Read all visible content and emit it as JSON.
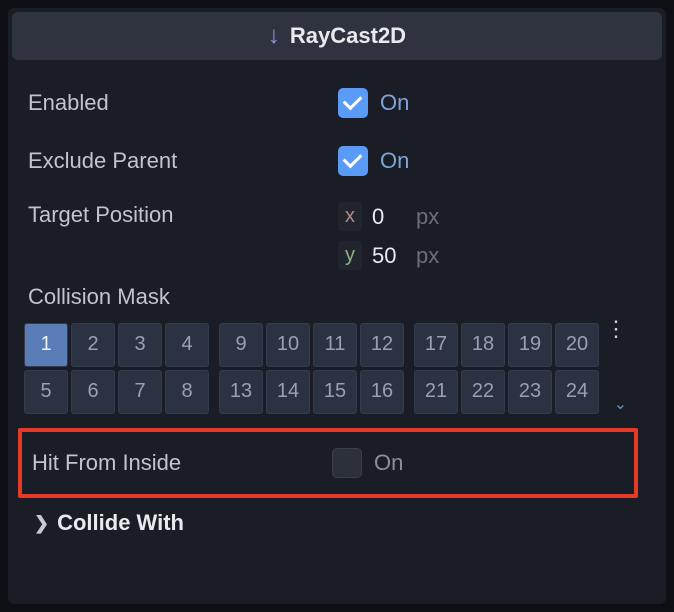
{
  "header": {
    "title": "RayCast2D"
  },
  "props": {
    "enabled": {
      "label": "Enabled",
      "checked": true,
      "text": "On"
    },
    "exclude_parent": {
      "label": "Exclude Parent",
      "checked": true,
      "text": "On"
    },
    "target_position": {
      "label": "Target Position",
      "x": {
        "axis": "x",
        "value": "0",
        "unit": "px"
      },
      "y": {
        "axis": "y",
        "value": "50",
        "unit": "px"
      }
    },
    "collision_mask": {
      "label": "Collision Mask",
      "active": [
        1
      ],
      "groups": [
        [
          1,
          2,
          3,
          4,
          5,
          6,
          7,
          8
        ],
        [
          9,
          10,
          11,
          12,
          13,
          14,
          15,
          16
        ],
        [
          17,
          18,
          19,
          20,
          21,
          22,
          23,
          24
        ]
      ]
    },
    "hit_from_inside": {
      "label": "Hit From Inside",
      "checked": false,
      "text": "On"
    },
    "collide_with": {
      "label": "Collide With"
    }
  }
}
